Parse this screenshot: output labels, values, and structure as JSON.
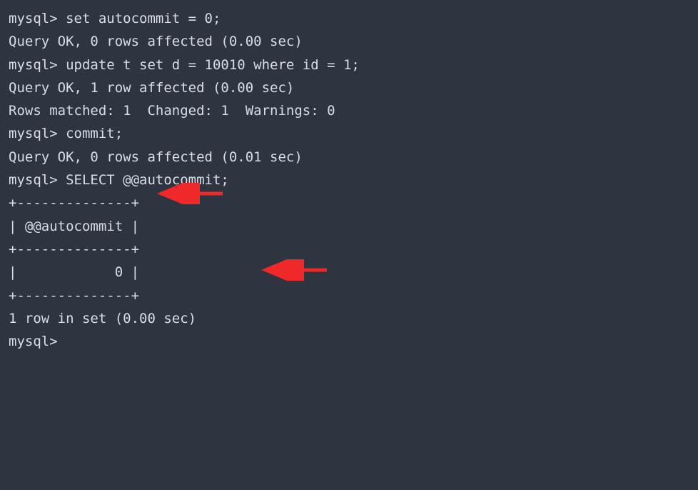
{
  "lines": {
    "l1": "mysql> set autocommit = 0;",
    "l2": "Query OK, 0 rows affected (0.00 sec)",
    "l3": "",
    "l4": "mysql> update t set d = 10010 where id = 1;",
    "l5": "Query OK, 1 row affected (0.00 sec)",
    "l6": "Rows matched: 1  Changed: 1  Warnings: 0",
    "l7": "",
    "l8": "mysql> commit;",
    "l9": "Query OK, 0 rows affected (0.01 sec)",
    "l10": "",
    "l11": "mysql> SELECT @@autocommit;",
    "l12": "+--------------+",
    "l13": "| @@autocommit |",
    "l14": "+--------------+",
    "l15": "|            0 |",
    "l16": "+--------------+",
    "l17": "1 row in set (0.00 sec)",
    "l18": "",
    "l19": "mysql>"
  },
  "annotations": {
    "arrow1_target": "commit",
    "arrow2_target": "SELECT @@autocommit"
  }
}
